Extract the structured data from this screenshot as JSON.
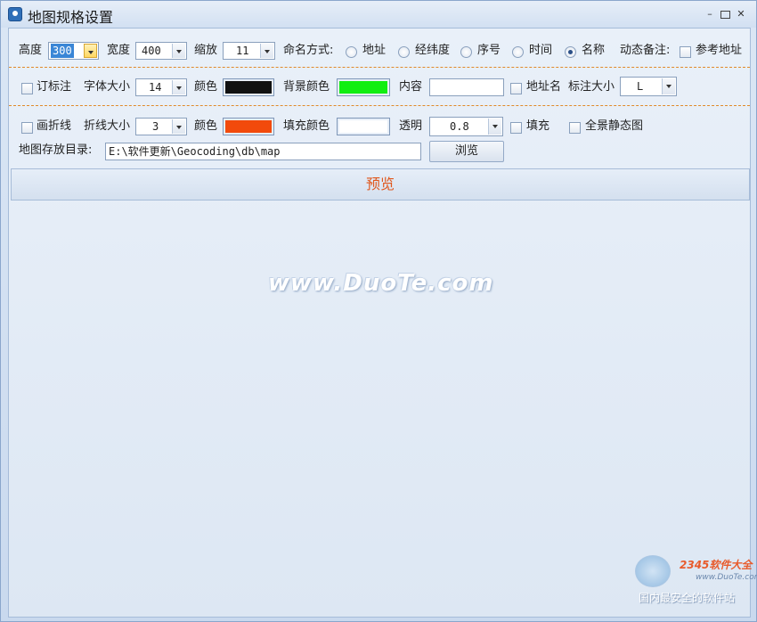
{
  "window": {
    "title": "地图规格设置"
  },
  "row1": {
    "height_label": "高度",
    "height_value": "300",
    "width_label": "宽度",
    "width_value": "400",
    "zoom_label": "缩放",
    "zoom_value": "11",
    "naming_label": "命名方式:",
    "naming_options": [
      "地址",
      "经纬度",
      "序号",
      "时间",
      "名称"
    ],
    "naming_selected": "名称",
    "dynamic_note_label": "动态备注:",
    "ref_address_label": "参考地址"
  },
  "row2": {
    "annotate_label": "订标注",
    "font_size_label": "字体大小",
    "font_size_value": "14",
    "color_label": "颜色",
    "text_color": "#111111",
    "bg_color_label": "背景颜色",
    "bg_color": "#11ee11",
    "content_label": "内容",
    "content_value": "",
    "address_name_label": "地址名",
    "label_size_label": "标注大小",
    "label_size_value": "L"
  },
  "row3": {
    "polyline_label": "画折线",
    "line_size_label": "折线大小",
    "line_size_value": "3",
    "color_label": "颜色",
    "line_color": "#f24a0c",
    "fill_color_label": "填充颜色",
    "fill_color": "#ffffff",
    "opacity_label": "透明",
    "opacity_value": "0.8",
    "fill_label": "填充",
    "panorama_label": "全景静态图"
  },
  "row4": {
    "dir_label": "地图存放目录:",
    "dir_value": "E:\\软件更新\\Geocoding\\db\\map",
    "browse_label": "浏览"
  },
  "preview_label": "预览",
  "watermark": "www.DuoTe.com",
  "branding": {
    "logo_text": "2345软件大全",
    "logo_url": "www.DuoTe.com",
    "slogan": "国内最安全的软件站"
  }
}
